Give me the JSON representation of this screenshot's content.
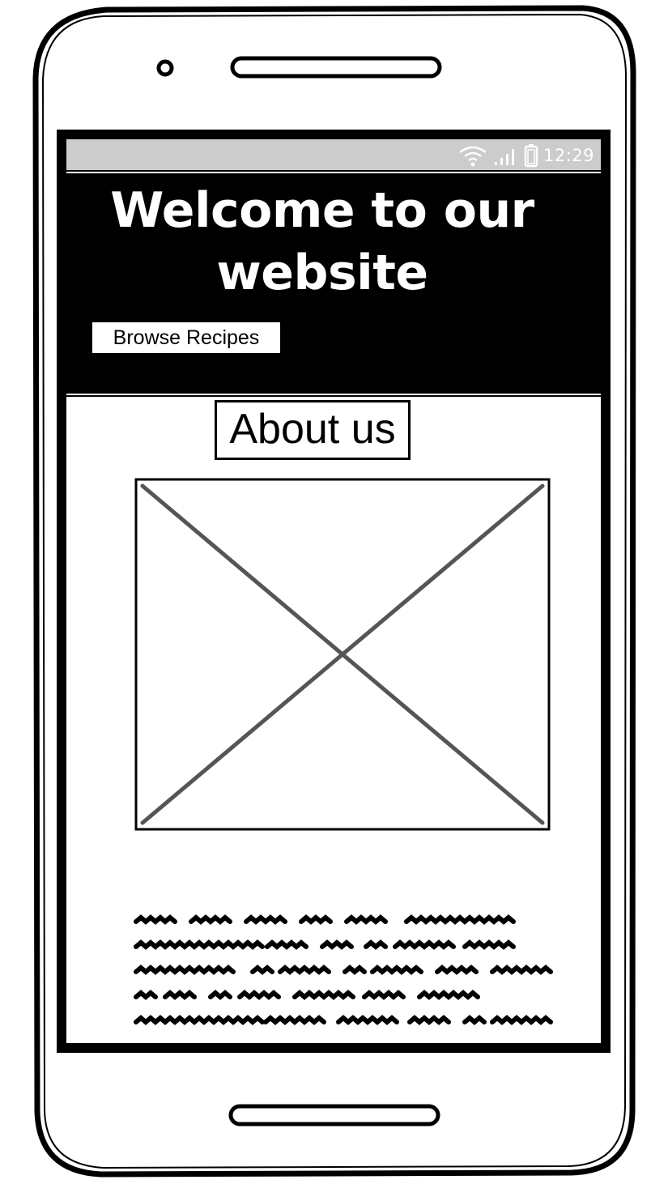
{
  "status_bar": {
    "wifi_icon": "wifi-icon",
    "signal_icon": "signal-icon",
    "battery_icon": "battery-icon",
    "time": "12:29"
  },
  "hero": {
    "title": "Welcome to our website",
    "browse_button_label": "Browse Recipes"
  },
  "about": {
    "heading": "About us",
    "image_icon": "image-placeholder-icon",
    "body_icon": "placeholder-text-scribble"
  },
  "colors": {
    "status_bar": "#cccccc",
    "hero_background": "#000000",
    "hero_text": "#ffffff",
    "placeholder_cross": "#555555"
  }
}
